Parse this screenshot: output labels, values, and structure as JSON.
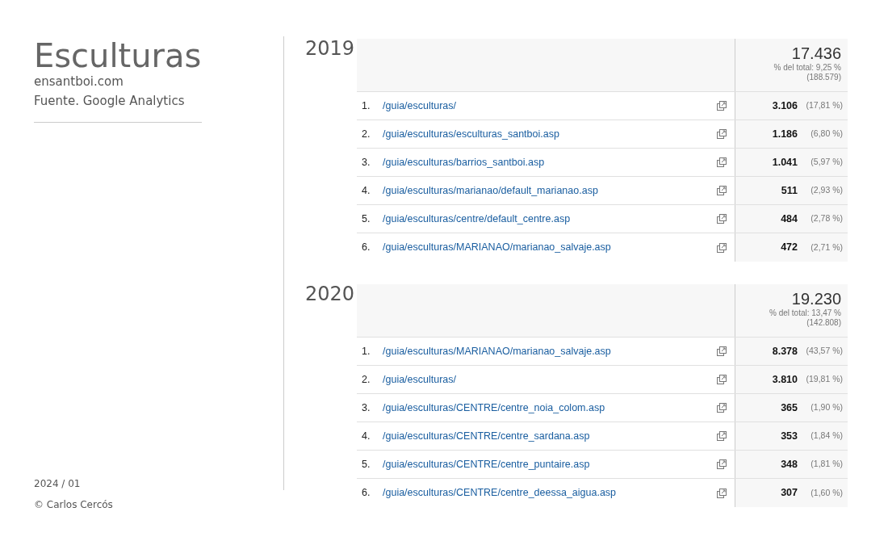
{
  "sidebar": {
    "title": "Esculturas",
    "site": "ensantboi.com",
    "source": "Fuente. Google Analytics",
    "date": "2024 / 01",
    "copyright": "© Carlos Cercós"
  },
  "sections": [
    {
      "year": "2019",
      "total": "17.436",
      "share": "% del total: 9,25 %",
      "overall": "(188.579)",
      "rows": [
        {
          "rank": "1.",
          "page": "/guia/esculturas/",
          "views": "3.106",
          "percent": "(17,81 %)"
        },
        {
          "rank": "2.",
          "page": "/guia/esculturas/esculturas_santboi.asp",
          "views": "1.186",
          "percent": "(6,80 %)"
        },
        {
          "rank": "3.",
          "page": "/guia/esculturas/barrios_santboi.asp",
          "views": "1.041",
          "percent": "(5,97 %)"
        },
        {
          "rank": "4.",
          "page": "/guia/esculturas/marianao/default_marianao.asp",
          "views": "511",
          "percent": "(2,93 %)"
        },
        {
          "rank": "5.",
          "page": "/guia/esculturas/centre/default_centre.asp",
          "views": "484",
          "percent": "(2,78 %)"
        },
        {
          "rank": "6.",
          "page": "/guia/esculturas/MARIANAO/marianao_salvaje.asp",
          "views": "472",
          "percent": "(2,71 %)"
        }
      ]
    },
    {
      "year": "2020",
      "total": "19.230",
      "share": "% del total: 13,47 %",
      "overall": "(142.808)",
      "rows": [
        {
          "rank": "1.",
          "page": "/guia/esculturas/MARIANAO/marianao_salvaje.asp",
          "views": "8.378",
          "percent": "(43,57 %)"
        },
        {
          "rank": "2.",
          "page": "/guia/esculturas/",
          "views": "3.810",
          "percent": "(19,81 %)"
        },
        {
          "rank": "3.",
          "page": "/guia/esculturas/CENTRE/centre_noia_colom.asp",
          "views": "365",
          "percent": "(1,90 %)"
        },
        {
          "rank": "4.",
          "page": "/guia/esculturas/CENTRE/centre_sardana.asp",
          "views": "353",
          "percent": "(1,84 %)"
        },
        {
          "rank": "5.",
          "page": "/guia/esculturas/CENTRE/centre_puntaire.asp",
          "views": "348",
          "percent": "(1,81 %)"
        },
        {
          "rank": "6.",
          "page": "/guia/esculturas/CENTRE/centre_deessa_aigua.asp",
          "views": "307",
          "percent": "(1,60 %)"
        }
      ]
    }
  ]
}
